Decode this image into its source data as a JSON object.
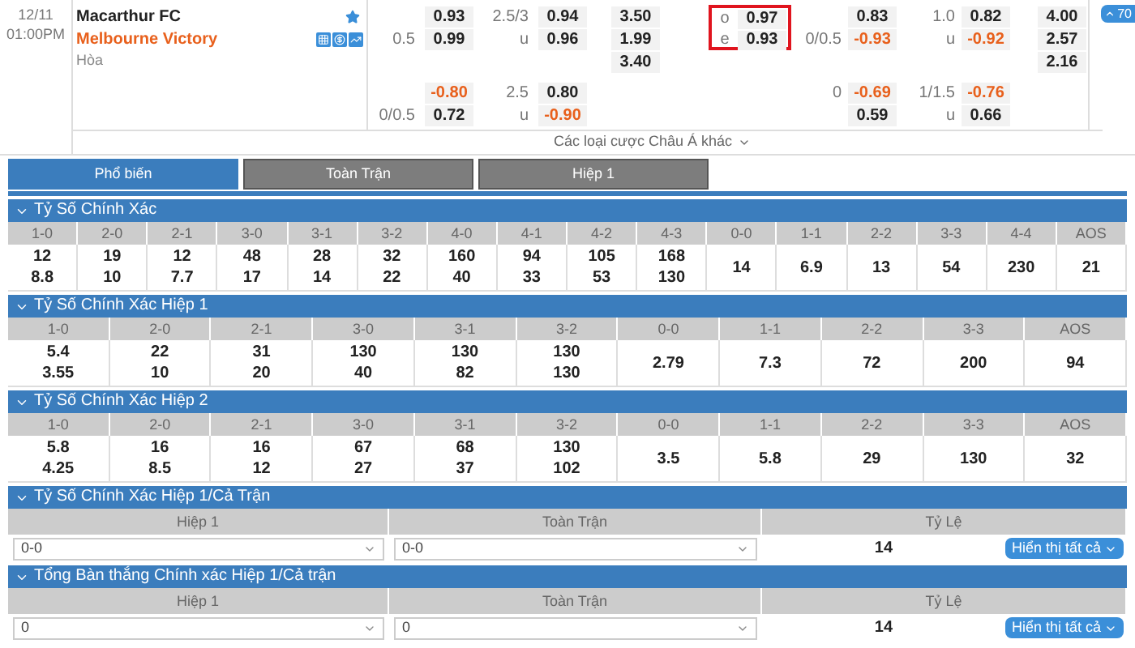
{
  "match": {
    "date": "12/11",
    "time": "01:00PM",
    "home": "Macarthur FC",
    "away": "Melbourne Victory",
    "draw": "Hòa",
    "starred": true
  },
  "main_odds": [
    {
      "ah": "0.93",
      "ou_line": "2.5/3",
      "ou": "0.94",
      "x12": "3.50",
      "oe_label": "o",
      "oe": "0.97",
      "h1_ah": "0.83",
      "h1_ou_line": "1.0",
      "h1_ou": "0.82",
      "h1_x12": "4.00"
    },
    {
      "ah_line": "0.5",
      "ah": "0.99",
      "ou_line": "u",
      "ou": "0.96",
      "x12": "1.99",
      "oe_label": "e",
      "oe": "0.93",
      "h1_ah_line": "0/0.5",
      "h1_ah": "-0.93",
      "h1_ou_line": "u",
      "h1_ou": "-0.92",
      "h1_x12": "2.57"
    },
    {
      "x12": "3.40",
      "h1_x12": "2.16"
    }
  ],
  "odd_even_highlighted": true,
  "alt_odds": [
    {
      "ah": "-0.80",
      "ou_line": "2.5",
      "ou": "0.80",
      "h1_ah_line": "0",
      "h1_ah": "-0.69",
      "h1_ou_line": "1/1.5",
      "h1_ou": "-0.76"
    },
    {
      "ah_line": "0/0.5",
      "ah": "0.72",
      "ou_line": "u",
      "ou": "-0.90",
      "h1_ah": "0.59",
      "h1_ou_line": "u",
      "h1_ou": "0.66"
    }
  ],
  "more_bets_link": "Các loại cược Châu Á khác",
  "more_button": "70",
  "tabs": [
    {
      "label": "Phổ biến",
      "selected": true
    },
    {
      "label": "Toàn Trận",
      "selected": false
    },
    {
      "label": "Hiệp 1",
      "selected": false
    }
  ],
  "sections": [
    {
      "kind": "grid",
      "title": "Tỷ Số Chính Xác",
      "expanded": true,
      "columns": [
        "1-0",
        "2-0",
        "2-1",
        "3-0",
        "3-1",
        "3-2",
        "4-0",
        "4-1",
        "4-2",
        "4-3",
        "0-0",
        "1-1",
        "2-2",
        "3-3",
        "4-4",
        "AOS"
      ],
      "cells": [
        [
          "12",
          "8.8"
        ],
        [
          "19",
          "10"
        ],
        [
          "12",
          "7.7"
        ],
        [
          "48",
          "17"
        ],
        [
          "28",
          "14"
        ],
        [
          "32",
          "22"
        ],
        [
          "160",
          "40"
        ],
        [
          "94",
          "33"
        ],
        [
          "105",
          "53"
        ],
        [
          "168",
          "130"
        ],
        [
          "14"
        ],
        [
          "6.9"
        ],
        [
          "13"
        ],
        [
          "54"
        ],
        [
          "230"
        ],
        [
          "21"
        ]
      ]
    },
    {
      "kind": "grid",
      "title": "Tỷ Số Chính Xác Hiệp 1",
      "expanded": true,
      "columns": [
        "1-0",
        "2-0",
        "2-1",
        "3-0",
        "3-1",
        "3-2",
        "0-0",
        "1-1",
        "2-2",
        "3-3",
        "AOS"
      ],
      "cells": [
        [
          "5.4",
          "3.55"
        ],
        [
          "22",
          "10"
        ],
        [
          "31",
          "20"
        ],
        [
          "130",
          "40"
        ],
        [
          "130",
          "82"
        ],
        [
          "130",
          "130"
        ],
        [
          "2.79"
        ],
        [
          "7.3"
        ],
        [
          "72"
        ],
        [
          "200"
        ],
        [
          "94"
        ]
      ]
    },
    {
      "kind": "grid",
      "title": "Tỷ Số Chính Xác Hiệp 2",
      "expanded": true,
      "columns": [
        "1-0",
        "2-0",
        "2-1",
        "3-0",
        "3-1",
        "3-2",
        "0-0",
        "1-1",
        "2-2",
        "3-3",
        "AOS"
      ],
      "cells": [
        [
          "5.8",
          "4.25"
        ],
        [
          "16",
          "8.5"
        ],
        [
          "16",
          "12"
        ],
        [
          "67",
          "27"
        ],
        [
          "68",
          "37"
        ],
        [
          "130",
          "102"
        ],
        [
          "3.5"
        ],
        [
          "5.8"
        ],
        [
          "29"
        ],
        [
          "130"
        ],
        [
          "32"
        ]
      ]
    },
    {
      "kind": "combo",
      "title": "Tỷ Số Chính Xác Hiệp 1/Cả Trận",
      "expanded": true,
      "columns": [
        "Hiệp 1",
        "Toàn Trận",
        "Tỷ Lệ"
      ],
      "selects": [
        "0-0",
        "0-0"
      ],
      "rate": "14",
      "button": "Hiển thị tất cả"
    },
    {
      "kind": "combo",
      "title": "Tổng Bàn thắng Chính xác Hiệp 1/Cả trận",
      "expanded": true,
      "columns": [
        "Hiệp 1",
        "Toàn Trận",
        "Tỷ Lệ"
      ],
      "selects": [
        "0",
        "0"
      ],
      "rate": "14",
      "button": "Hiển thị tất cả"
    }
  ]
}
